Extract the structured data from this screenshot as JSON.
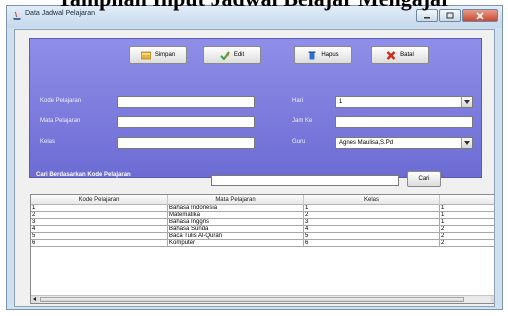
{
  "page_heading": "Tampilan Input Jadwal Belajar Mengajar",
  "window": {
    "title": "Data Jadwal Pelajaran"
  },
  "toolbar": {
    "save": "Simpan",
    "edit": "Edit",
    "delete": "Hapus",
    "cancel": "Batal"
  },
  "form": {
    "kode_label": "Kode Pelajaran",
    "mata_label": "Mata Pelajaran",
    "kelas_label": "Kelas",
    "hari_label": "Hari",
    "hari_value": "1",
    "jam_label": "Jam Ke",
    "guru_label": "Guru",
    "guru_value": "Agnes Maulisa,S.Pd"
  },
  "search": {
    "label": "Cari Berdasarkan Kode Pelajaran",
    "button": "Cari"
  },
  "table": {
    "headers": [
      "Kode Pelajaran",
      "Mata Pelajaran",
      "Kelas",
      ""
    ],
    "rows": [
      [
        "1",
        "Bahasa Indonesia",
        "1",
        "1"
      ],
      [
        "2",
        "Matematika",
        "2",
        "1"
      ],
      [
        "3",
        "Bahasa Inggris",
        "3",
        "1"
      ],
      [
        "4",
        "Bahasa Sunda",
        "4",
        "2"
      ],
      [
        "5",
        "Baca Tulis Al-Quran",
        "5",
        "2"
      ],
      [
        "6",
        "Komputer",
        "6",
        "2"
      ]
    ]
  },
  "colors": {
    "panel": "#7e7de0",
    "window_bg": "#cfe0f1",
    "close_button": "#c84a33"
  },
  "icons": [
    "java-app-icon",
    "save-icon",
    "edit-icon",
    "delete-icon",
    "cancel-icon",
    "dropdown-arrow-icon"
  ]
}
